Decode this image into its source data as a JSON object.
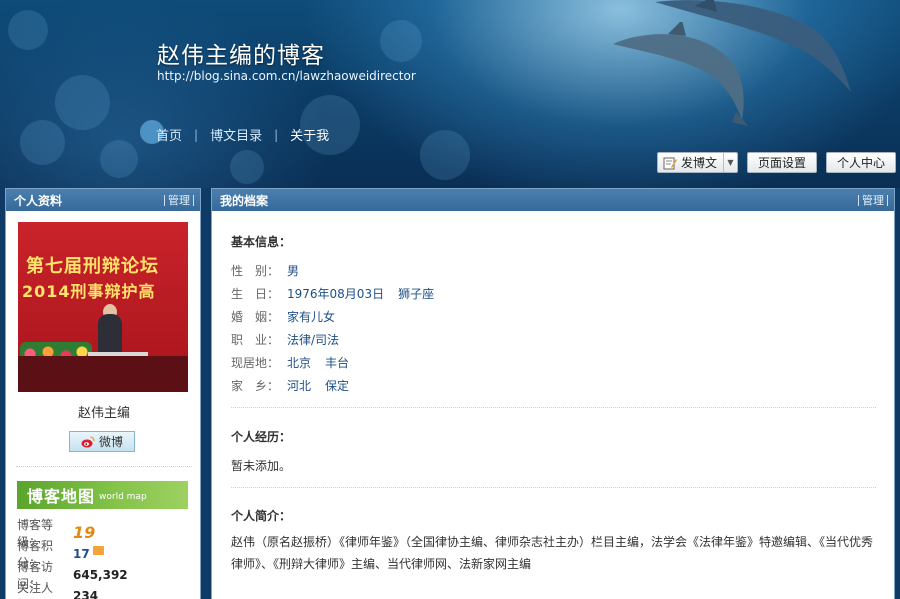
{
  "header": {
    "blog_title": "赵伟主编的博客",
    "blog_url": "http://blog.sina.com.cn/lawzhaoweidirector",
    "nav": [
      {
        "label": "首页",
        "active": false
      },
      {
        "label": "博文目录",
        "active": false
      },
      {
        "label": "关于我",
        "active": true
      }
    ],
    "toolbar": {
      "write_label": "发博文",
      "page_settings_label": "页面设置",
      "personal_center_label": "个人中心"
    }
  },
  "left_panel": {
    "title": "个人资料",
    "manage_label": "管理",
    "avatar_banner_line1": "第七届刑辩论坛",
    "avatar_banner_line2": "2014刑事辩护高",
    "name": "赵伟主编",
    "weibo_label": "微博",
    "blog_map": {
      "title": "博客地图",
      "subtitle": "world map"
    },
    "stats": [
      {
        "key": "博客等级：",
        "value": "19"
      },
      {
        "key": "博客积分：",
        "value": "17"
      },
      {
        "key": "博客访问：",
        "value": "645,392"
      },
      {
        "key": "关注人气：",
        "value": "234"
      }
    ]
  },
  "right_panel": {
    "title": "我的档案",
    "manage_label": "管理",
    "basic_info_title": "基本信息：",
    "basic_info": [
      {
        "key": "性　别：",
        "value": "男",
        "extra": ""
      },
      {
        "key": "生　日：",
        "value": "1976年08月03日",
        "extra": "狮子座"
      },
      {
        "key": "婚　姻：",
        "value": "家有儿女",
        "extra": ""
      },
      {
        "key": "职　业：",
        "value": "法律/司法",
        "extra": ""
      },
      {
        "key": "现居地：",
        "value": "北京",
        "extra": "丰台"
      },
      {
        "key": "家　乡：",
        "value": "河北",
        "extra": "保定"
      }
    ],
    "experience_title": "个人经历：",
    "experience_text": "暂未添加。",
    "intro_title": "个人简介：",
    "intro_text": "赵伟（原名赵振桥）《律师年鉴》（全国律协主编、律师杂志社主办）栏目主编，法学会《法律年鉴》特邀编辑、《当代优秀律师》、《刑辩大律师》主编、当代律师网、法新家网主编"
  },
  "colors": {
    "panel_header": "#356a9b",
    "link_blue": "#1e4f87",
    "level_orange": "#e08a12",
    "map_green": "#5aa52d"
  }
}
